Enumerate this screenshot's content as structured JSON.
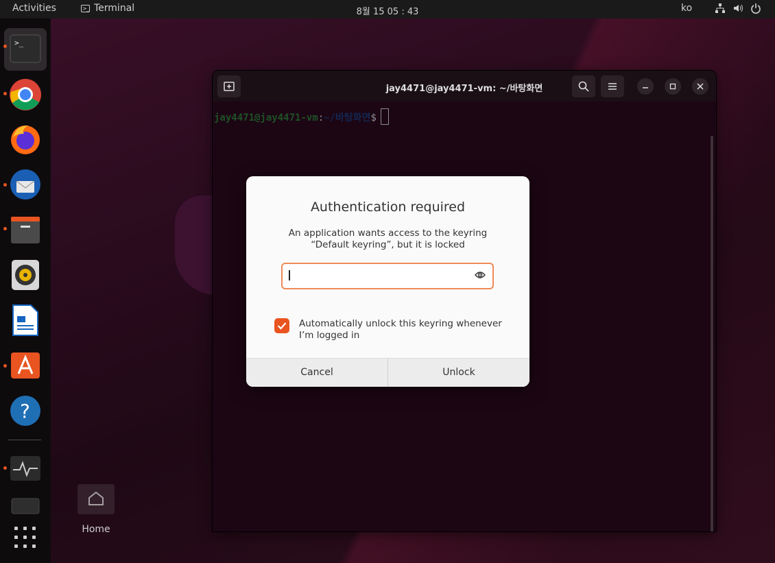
{
  "topbar": {
    "activities": "Activities",
    "app_name": "Terminal",
    "clock": "8월 15  05 : 43",
    "language": "ko"
  },
  "dock": {
    "items": [
      "Terminal",
      "Chrome",
      "Firefox",
      "Thunderbird",
      "Files",
      "Rhythmbox",
      "LibreOffice Writer",
      "Ubuntu Software",
      "Help",
      "System Monitor",
      "Drive",
      "Show Applications"
    ]
  },
  "desktop": {
    "home_label": "Home"
  },
  "terminal": {
    "title": "jay4471@jay4471-vm: ~/바탕화면",
    "prompt_user": "jay4471@jay4471-vm",
    "prompt_colon": ":",
    "prompt_path": "~/바탕화면",
    "prompt_symbol": "$"
  },
  "dialog": {
    "title": "Authentication required",
    "message_line1": "An application wants access to the keyring",
    "message_line2": "“Default keyring”, but it is locked",
    "password_value": "",
    "checkbox_checked": true,
    "checkbox_label": "Automatically unlock this keyring whenever I’m logged in",
    "cancel_label": "Cancel",
    "unlock_label": "Unlock"
  },
  "colors": {
    "accent": "#e95420",
    "focus_border": "#f08a57",
    "terminal_bg": "#2c0a20"
  }
}
